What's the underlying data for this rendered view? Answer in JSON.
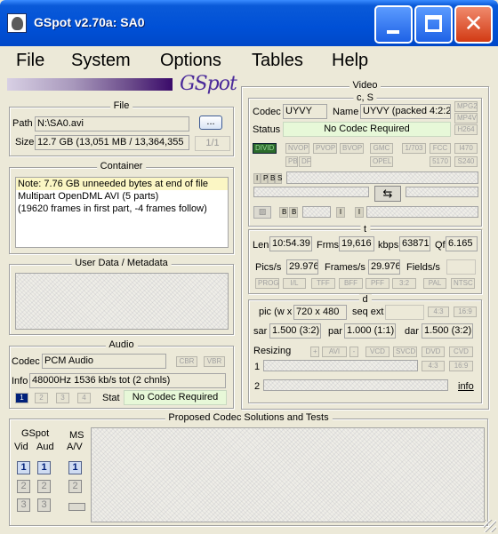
{
  "window": {
    "title": "GSpot v2.70a: SA0"
  },
  "menu": [
    "File",
    "System",
    "Options",
    "Tables",
    "Help"
  ],
  "logo": {
    "text": "GSpot"
  },
  "file": {
    "group_title": "File",
    "path_label": "Path",
    "path_value": "N:\\SA0.avi",
    "browse_label": "...",
    "size_label": "Size",
    "size_value": "12.7 GB (13,051 MB / 13,364,355",
    "part_label": "1/1"
  },
  "container": {
    "group_title": "Container",
    "lines": [
      "Note: 7.76 GB unneeded bytes at end of file",
      "Multipart OpenDML AVI (5 parts)",
      "(19620 frames in first part, -4 frames follow)"
    ]
  },
  "userdata": {
    "group_title": "User Data / Metadata"
  },
  "audio": {
    "group_title": "Audio",
    "codec_label": "Codec",
    "codec_value": "PCM Audio",
    "cbr_label": "CBR",
    "vbr_label": "VBR",
    "info_label": "Info",
    "info_value": "48000Hz  1536 kb/s tot (2 chnls)",
    "stream_buttons": [
      "1",
      "2",
      "3",
      "4"
    ],
    "stat_label": "Stat",
    "stat_value": "No Codec Required"
  },
  "video": {
    "group_title": "Video",
    "cs_title": "c, S",
    "codec_label": "Codec",
    "codec_value": "UYVY",
    "name_label": "Name",
    "name_value": "UYVY (packed 4:2:2",
    "status_label": "Status",
    "status_value": "No Codec Required",
    "side_tags": [
      "MPG2",
      "MP4V",
      "H264"
    ],
    "flags_row1": [
      "DIVID",
      "NVOP",
      "PVOP",
      "BVOP",
      "GMC",
      "1/703",
      "FCC",
      "I470"
    ],
    "flags_row2": [
      "PB",
      "DF",
      "OPEL",
      "5170",
      "S240"
    ],
    "frame_types": [
      "I",
      "P",
      "B",
      "S"
    ],
    "nav_letters": [
      "B",
      "B",
      "I",
      "I"
    ],
    "t_title": "t",
    "len_label": "Len",
    "len_value": "10:54.39",
    "frms_label": "Frms",
    "frms_value": "19,616",
    "kbps_label": "kbps",
    "kbps_value": "63871",
    "qf_label": "Qf",
    "qf_value": "6.165",
    "pics_label": "Pics/s",
    "pics_value": "29.976",
    "frames_label": "Frames/s",
    "frames_value": "29.976",
    "fields_label": "Fields/s",
    "scan_tags": [
      "PROG",
      "I/L",
      "TFF",
      "BFF",
      "PFF",
      "3:2",
      "PAL",
      "NTSC"
    ],
    "d_title": "d",
    "pic_label": "pic (w x",
    "pic_value": "720 x 480",
    "seqext_label": "seq ext",
    "ar_tags": [
      "4:3",
      "16:9"
    ],
    "sar_label": "sar",
    "sar_value": "1.500 (3:2)",
    "par_label": "par",
    "par_value": "1.000 (1:1)",
    "dar_label": "dar",
    "dar_value": "1.500 (3:2)",
    "resizing_label": "Resizing",
    "resize_tags": [
      "+",
      "AVI",
      "-",
      "VCD",
      "SVCD",
      "DVD",
      "CVD"
    ],
    "resize_ar_tags": [
      "4:3",
      "16:9"
    ],
    "row1_label": "1",
    "row2_label": "2",
    "info_link": "info"
  },
  "proposed": {
    "group_title": "Proposed Codec Solutions and Tests",
    "gspot_label": "GSpot",
    "vid_label": "Vid",
    "aud_label": "Aud",
    "ms_label": "MS",
    "av_label": "A/V",
    "numbers": [
      "1",
      "2",
      "3"
    ]
  }
}
